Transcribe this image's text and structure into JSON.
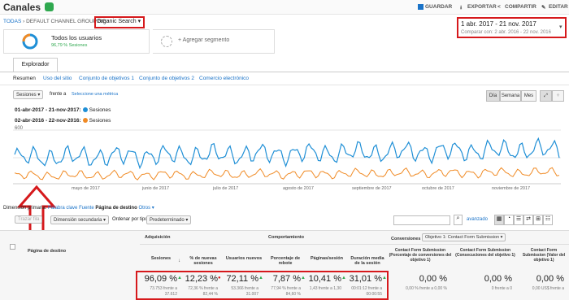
{
  "header": {
    "title": "Canales",
    "save": "GUARDAR",
    "export": "EXPORTAR",
    "share": "COMPARTIR",
    "edit": "EDITAR"
  },
  "breadcrumb": {
    "all": "TODAS",
    "sep": "›",
    "grouping": "DEFAULT CHANNEL GROUPING",
    "sep2": "›",
    "dimension": "Organic Search"
  },
  "date_range": {
    "primary": "1 abr. 2017 - 21 nov. 2017",
    "compare_label": "Comparar con:",
    "compare": "2 abr. 2016 - 22 nov. 2016"
  },
  "segments": {
    "seg1_title": "Todos los usuarios",
    "seg1_sub": "96,79 % Sesiones",
    "add": "+ Agregar segmento"
  },
  "tabs": {
    "explorer": "Explorador"
  },
  "subnav": {
    "summary": "Resumen",
    "site_usage": "Uso del sitio",
    "goalset1": "Conjunto de objetivos 1",
    "goalset2": "Conjunto de objetivos 2",
    "ecommerce": "Comercio electrónico"
  },
  "metric_row": {
    "metric": "Sesiones",
    "vs": "frente a",
    "select": "Seleccione una métrica",
    "day": "Día",
    "week": "Semana",
    "month": "Mes"
  },
  "legend": {
    "range1": "01-abr-2017 - 21-nov-2017:",
    "range2": "02-abr-2016 - 22-nov-2016:",
    "series": "Sesiones"
  },
  "chart_data": {
    "type": "line",
    "y_tick": "600",
    "x_ticks": [
      "mayo de 2017",
      "junio de 2017",
      "julio de 2017",
      "agosto de 2017",
      "septiembre de 2017",
      "octubre de 2017",
      "noviembre de 2017"
    ],
    "series": [
      {
        "name": "Sesiones",
        "range": "01-abr-2017 - 21-nov-2017",
        "color": "#1f8fd6"
      },
      {
        "name": "Sesiones",
        "range": "02-abr-2016 - 22-nov-2016",
        "color": "#f08a24"
      }
    ],
    "ylim": [
      0,
      600
    ]
  },
  "dims": {
    "primary": "Dimensión primaria:",
    "keyword": "Palabra clave",
    "source": "Fuente",
    "landing": "Página de destino",
    "other": "Otros"
  },
  "controls": {
    "plot": "Trazar fila",
    "secondary": "Dimensión secundaria",
    "sort": "Ordenar por tipo:",
    "sort_val": "Predeterminado",
    "advanced": "avanzado"
  },
  "table": {
    "landing_header": "Página de destino",
    "acq": "Adquisición",
    "behavior": "Comportamiento",
    "conversions": "Conversiones",
    "goal": "Objetivo 1: Contact Form Submission",
    "cols": [
      "Sesiones",
      "% de nuevas sesiones",
      "Usuarios nuevos",
      "Porcentaje de rebote",
      "Páginas/sesión",
      "Duración media de la sesión",
      "Contact Form Submission (Porcentaje de conversiones del objetivo 1)",
      "Contact Form Submission (Consecuciones del objetivo 1)",
      "Contact Form Submission (Valor del objetivo 1)"
    ],
    "vals": [
      "96,09 %",
      "12,23 %",
      "72,11 %",
      "7,87 %",
      "10,41 %",
      "31,01 %",
      "0,00 %",
      "0,00 %",
      "0,00 %"
    ],
    "subs": [
      [
        "73.753 frente a",
        "37.612"
      ],
      [
        "72,36 % frente a",
        "82,44 %"
      ],
      [
        "53.366 frente a",
        "31.007"
      ],
      [
        "77,94 % frente a",
        "84,60 %"
      ],
      [
        "1,43 frente a 1,30",
        ""
      ],
      [
        "00:01:12 frente a",
        "00:00:55"
      ],
      [
        "0,00 % frente a 0,00 %",
        ""
      ],
      [
        "0 frente a 0",
        ""
      ],
      [
        "0,00 US$ frente a",
        ""
      ]
    ]
  }
}
